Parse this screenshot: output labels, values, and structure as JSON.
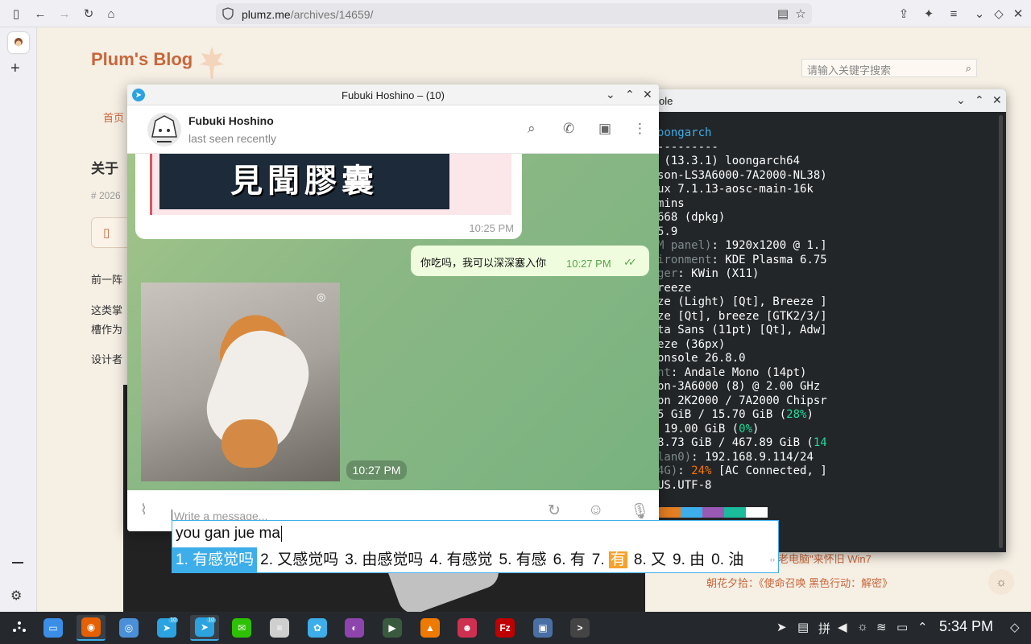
{
  "browser": {
    "url_host": "plumz.me",
    "url_path": "/archives/14659/"
  },
  "blog": {
    "title": "Plum's Blog",
    "search_placeholder": "请输入关键字搜索",
    "nav_home": "首页",
    "post_title_frag": "关于",
    "date_frag": "# 2026",
    "para1_frag": "前一阵",
    "para2a_frag": "这类掌",
    "para2b_frag": "槽作为",
    "para3_frag": "设计者",
    "related1": "老电脑\"来怀旧 Win7",
    "related2": "朝花夕拾：《使命召唤 黑色行动：解密》"
  },
  "konsole": {
    "title_frag": "ole",
    "lines": [
      [
        {
          "t": "oongarch",
          "c": "c-blue"
        }
      ],
      [
        {
          "t": "---------",
          "c": ""
        }
      ],
      [
        {
          "t": " (13.3.1) loongarch64",
          "c": ""
        }
      ],
      [
        {
          "t": "son-LS3A6000-7A2000-NL38)",
          "c": ""
        }
      ],
      [
        {
          "t": "ux 7.1.13-aosc-main-16k",
          "c": ""
        }
      ],
      [
        {
          "t": "mins",
          "c": ""
        }
      ],
      [
        {
          "t": "668 (dpkg)",
          "c": ""
        }
      ],
      [
        {
          "t": "5.9",
          "c": ""
        }
      ],
      [
        {
          "t": "M panel)",
          "c": "c-gray"
        },
        {
          "t": ": 1920x1200 @ 1.]",
          "c": ""
        }
      ],
      [
        {
          "t": "ironment",
          "c": "c-gray"
        },
        {
          "t": ": KDE Plasma 6.75",
          "c": ""
        }
      ],
      [
        {
          "t": "ger",
          "c": "c-gray"
        },
        {
          "t": ": KWin (X11)",
          "c": ""
        }
      ],
      [
        {
          "t": "reeze",
          "c": ""
        }
      ],
      [
        {
          "t": "ze (Light) [Qt], Breeze ]",
          "c": ""
        }
      ],
      [
        {
          "t": "ze [Qt], breeze [GTK2/3/]",
          "c": ""
        }
      ],
      [
        {
          "t": "ta Sans (11pt) [Qt], Adw]",
          "c": ""
        }
      ],
      [
        {
          "t": "eze (36px)",
          "c": ""
        }
      ],
      [
        {
          "t": "onsole 26.8.0",
          "c": ""
        }
      ],
      [
        {
          "t": "nt",
          "c": "c-gray"
        },
        {
          "t": ": Andale Mono (14pt)",
          "c": ""
        }
      ],
      [
        {
          "t": "on-3A6000 (8) @ 2.00 GHz",
          "c": ""
        }
      ],
      [
        {
          "t": "on 2K2000 / 7A2000 Chipsr",
          "c": ""
        }
      ],
      [
        {
          "t": "5 GiB / 15.70 GiB (",
          "c": ""
        },
        {
          "t": "28%",
          "c": "c-green"
        },
        {
          "t": ")",
          "c": ""
        }
      ],
      [
        {
          "t": " 19.00 GiB (",
          "c": ""
        },
        {
          "t": "0%",
          "c": "c-green"
        },
        {
          "t": ")",
          "c": ""
        }
      ],
      [
        {
          "t": "8.73 GiB / 467.89 GiB (",
          "c": ""
        },
        {
          "t": "14",
          "c": "c-green"
        }
      ],
      [
        {
          "t": "lan0)",
          "c": "c-gray"
        },
        {
          "t": ": 192.168.9.114/24",
          "c": ""
        }
      ],
      [
        {
          "t": "4G)",
          "c": "c-gray"
        },
        {
          "t": ": ",
          "c": ""
        },
        {
          "t": "24%",
          "c": "c-orange"
        },
        {
          "t": " [AC Connected, ]",
          "c": ""
        }
      ],
      [
        {
          "t": "US.UTF-8",
          "c": ""
        }
      ]
    ],
    "swatch_colors": [
      "#e67e22",
      "#3daee9",
      "#9b59b6",
      "#1abc9c",
      "#fcfcfc"
    ]
  },
  "telegram": {
    "window_title": "Fubuki Hoshino – (10)",
    "contact_name": "Fubuki Hoshino",
    "contact_status": "last seen recently",
    "quote_image_text": "見聞膠囊",
    "time_in": "10:25 PM",
    "out_message": "你吃吗，我可以深深塞入你",
    "out_time": "10:27 PM",
    "photo_time": "10:27 PM",
    "input_placeholder": "Write a message..."
  },
  "ime": {
    "preedit": "you gan jue ma",
    "candidates": [
      {
        "label": "1. 有感觉吗",
        "selected": true
      },
      {
        "label": "2. 又感觉吗",
        "selected": false
      },
      {
        "label": "3. 由感觉吗",
        "selected": false
      },
      {
        "label": "4. 有感觉",
        "selected": false
      },
      {
        "label": "5. 有感",
        "selected": false
      },
      {
        "label": "6. 有",
        "selected": false
      },
      {
        "label": "7.",
        "selected": false,
        "highlight": "有"
      },
      {
        "label": "8. 又",
        "selected": false
      },
      {
        "label": "9. 由",
        "selected": false
      },
      {
        "label": "0. 油",
        "selected": false
      }
    ]
  },
  "taskbar": {
    "clock": "5:34 PM",
    "badge_count": "10",
    "apps": [
      {
        "name": "file-manager-icon",
        "color": "#3a8ee6",
        "glyph": "▭"
      },
      {
        "name": "firefox-icon",
        "color": "#e66000",
        "glyph": "◉"
      },
      {
        "name": "chromium-icon",
        "color": "#4a90d9",
        "glyph": "◎"
      },
      {
        "name": "telegram-icon",
        "color": "#2aa3e0",
        "glyph": "➤"
      },
      {
        "name": "telegram-icon-2",
        "color": "#2aa3e0",
        "glyph": "➤"
      },
      {
        "name": "wechat-icon",
        "color": "#2dc100",
        "glyph": "✉"
      },
      {
        "name": "text-editor-icon",
        "color": "#cfcfcf",
        "glyph": "≡"
      },
      {
        "name": "qq-icon",
        "color": "#3daee9",
        "glyph": "✿"
      },
      {
        "name": "color-picker-icon",
        "color": "#8e44ad",
        "glyph": "◐"
      },
      {
        "name": "media-player-icon",
        "color": "#3a5a40",
        "glyph": "▶"
      },
      {
        "name": "vlc-icon",
        "color": "#ee7a00",
        "glyph": "▲"
      },
      {
        "name": "game-icon",
        "color": "#d03050",
        "glyph": "☻"
      },
      {
        "name": "filezilla-icon",
        "color": "#bf0000",
        "glyph": "Fz"
      },
      {
        "name": "remote-desktop-icon",
        "color": "#4a6fa5",
        "glyph": "▣"
      },
      {
        "name": "terminal-icon",
        "color": "#444",
        "glyph": "&gt;"
      }
    ]
  }
}
